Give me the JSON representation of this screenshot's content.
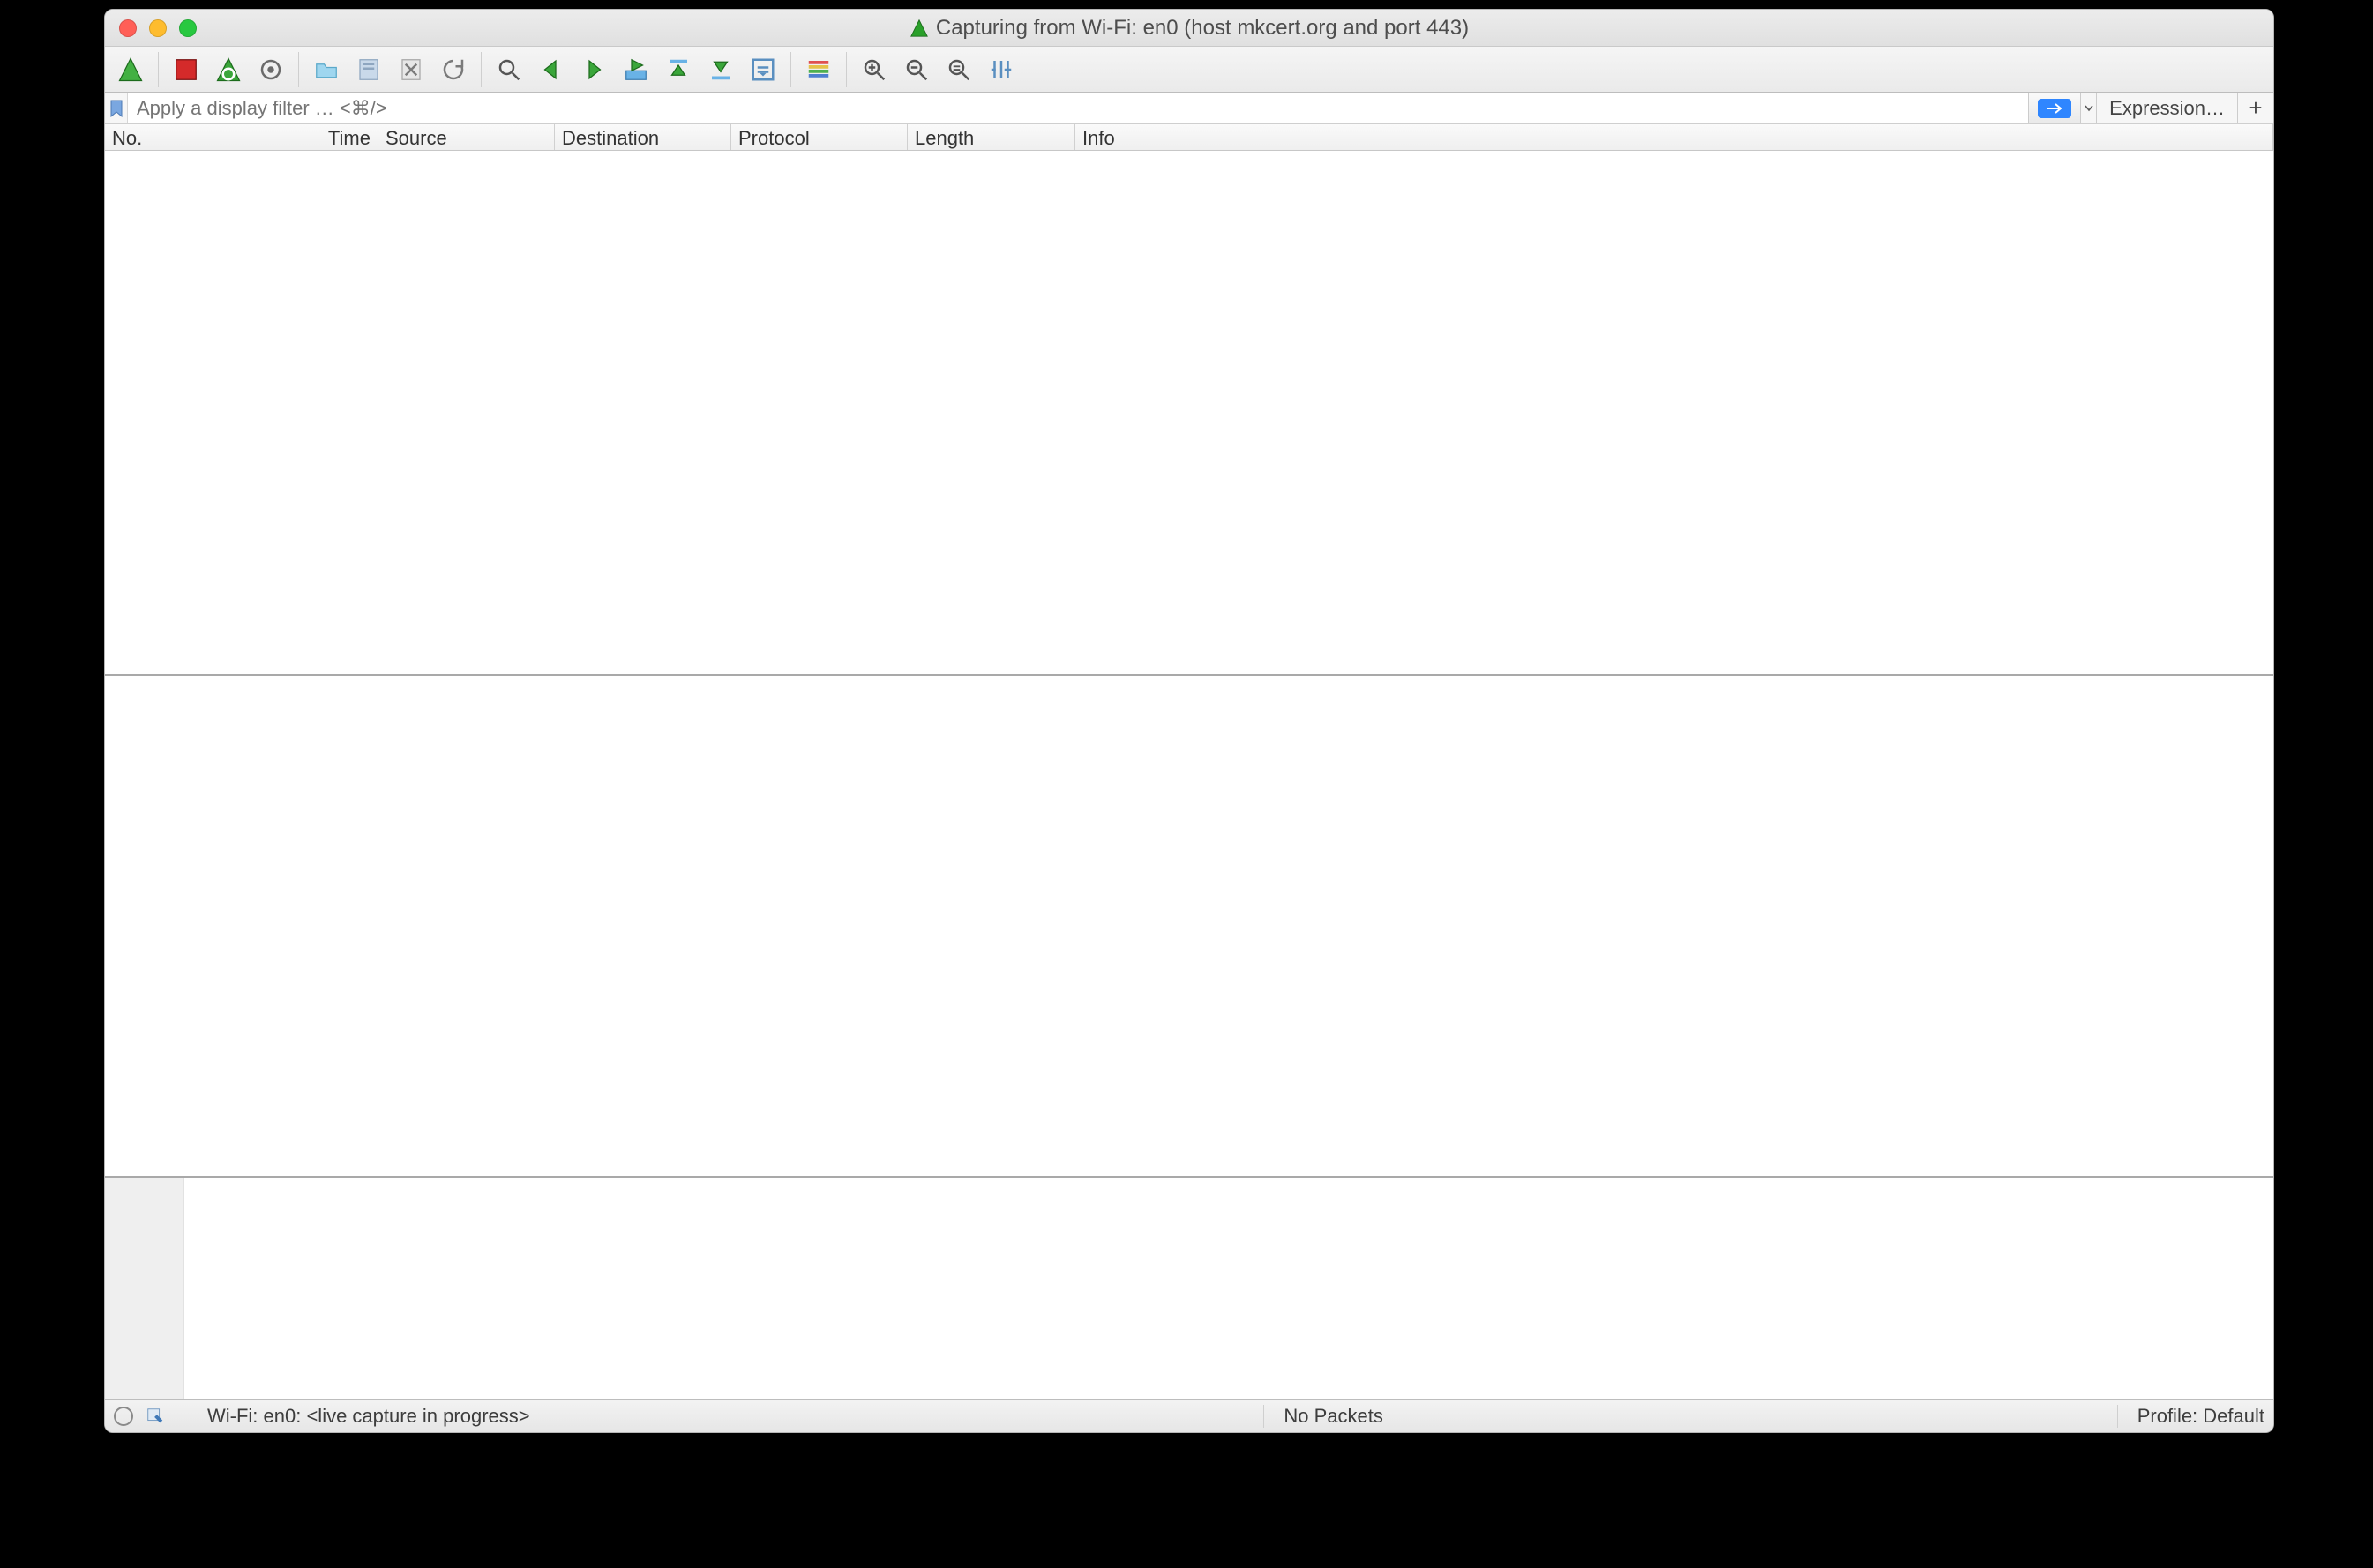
{
  "window": {
    "title": "Capturing from Wi-Fi: en0 (host mkcert.org and port 443)"
  },
  "filter": {
    "placeholder": "Apply a display filter … <⌘/>",
    "expression_label": "Expression…",
    "plus_label": "+"
  },
  "columns": {
    "no": "No.",
    "time": "Time",
    "source": "Source",
    "destination": "Destination",
    "protocol": "Protocol",
    "length": "Length",
    "info": "Info"
  },
  "status": {
    "interface": "Wi-Fi: en0: <live capture in progress>",
    "packets": "No Packets",
    "profile": "Profile: Default"
  },
  "toolbar_icons": {
    "start": "shark-fin-icon",
    "stop": "stop-icon",
    "restart": "restart-capture-icon",
    "options": "gear-icon",
    "open": "folder-open-icon",
    "save": "save-icon",
    "close": "close-file-icon",
    "reload": "reload-icon",
    "find": "find-icon",
    "prev": "arrow-left-icon",
    "next": "arrow-right-icon",
    "jump": "goto-packet-icon",
    "first": "go-first-icon",
    "last": "go-last-icon",
    "autoscroll": "autoscroll-icon",
    "colorize": "colorize-icon",
    "zoom_in": "zoom-in-icon",
    "zoom_out": "zoom-out-icon",
    "zoom_reset": "zoom-reset-icon",
    "resize_cols": "resize-columns-icon"
  }
}
